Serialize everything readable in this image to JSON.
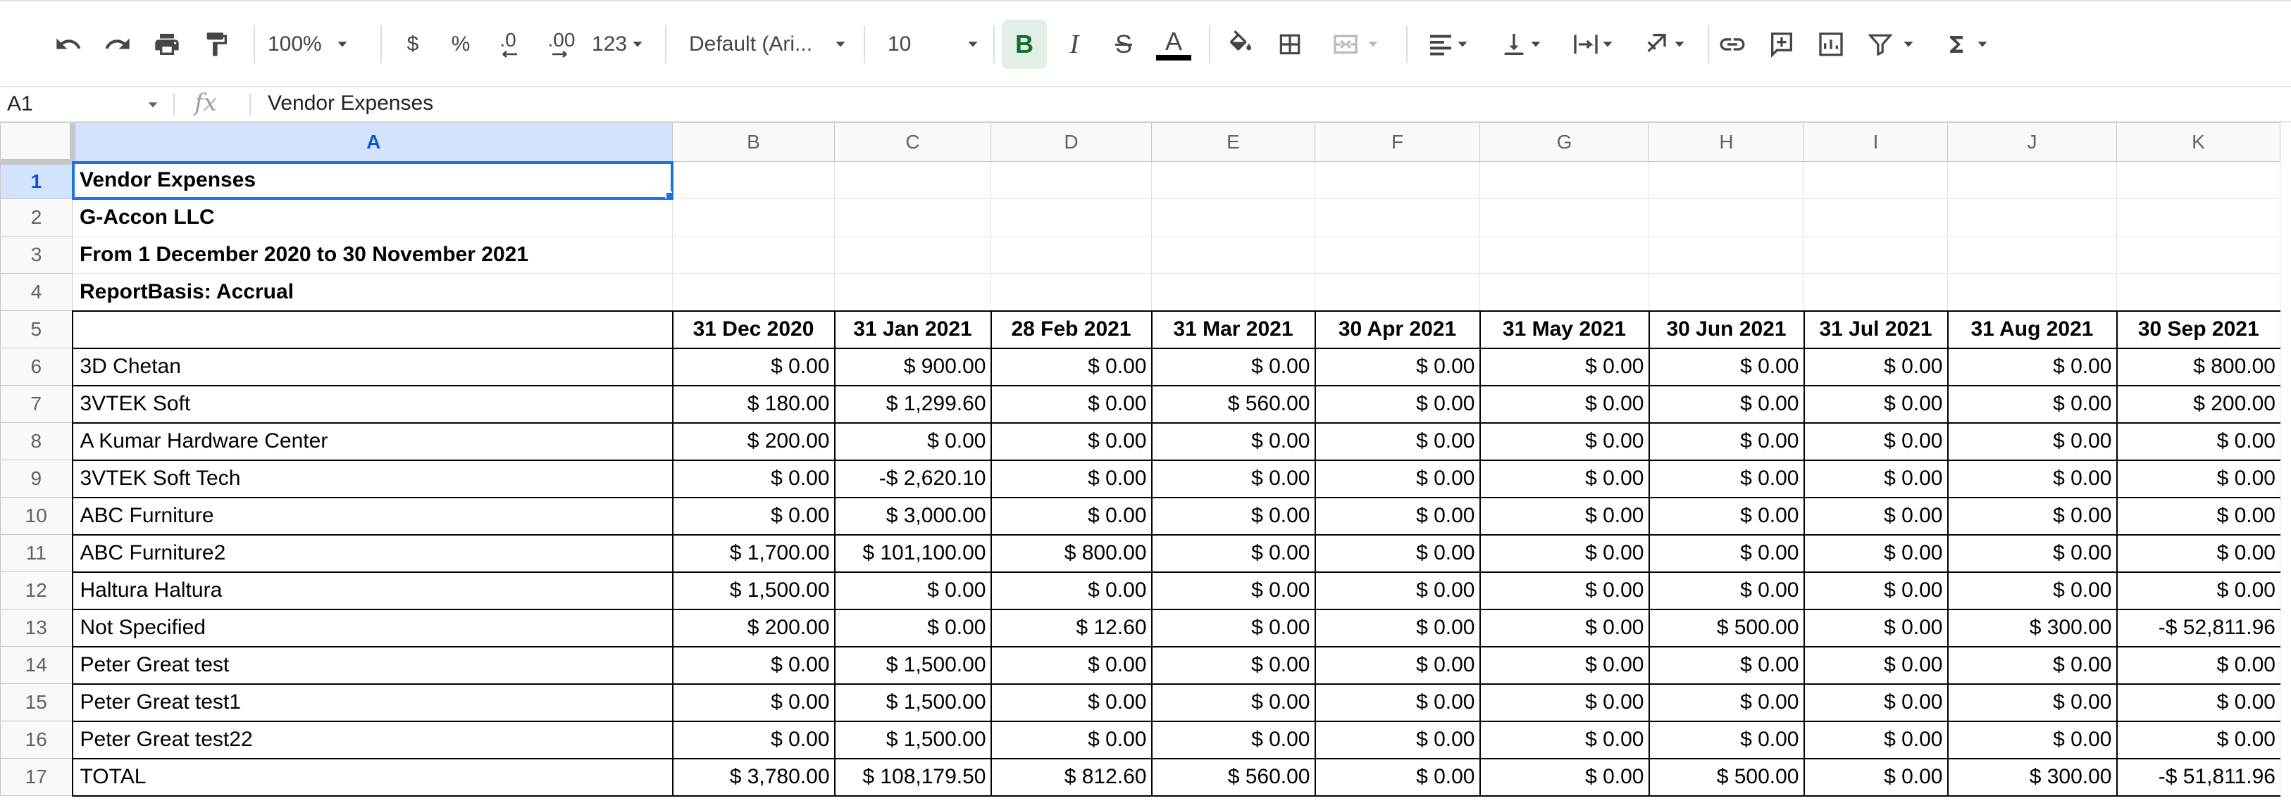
{
  "toolbar": {
    "zoom": "100%",
    "currency": "$",
    "percent": "%",
    "decrease_decimal": ".0",
    "increase_decimal": ".00",
    "more_formats": "123",
    "font_family": "Default (Ari...",
    "font_size": "10",
    "bold": "B",
    "italic": "I",
    "strikethrough": "S",
    "text_color": "A",
    "text_color_value": "#000000",
    "icons": [
      "undo-icon",
      "redo-icon",
      "print-icon",
      "paint-format-icon",
      "fill-color-icon",
      "borders-icon",
      "merge-cells-icon",
      "horizontal-align-icon",
      "vertical-align-icon",
      "text-wrapping-icon",
      "text-rotation-icon",
      "insert-link-icon",
      "insert-comment-icon",
      "insert-chart-icon",
      "filter-icon",
      "functions-icon"
    ]
  },
  "formula_bar": {
    "name_box": "A1",
    "fx": "fx",
    "content": "Vendor Expenses"
  },
  "columns": [
    "A",
    "B",
    "C",
    "D",
    "E",
    "F",
    "G",
    "H",
    "I",
    "J",
    "K"
  ],
  "rows": [
    "1",
    "2",
    "3",
    "4",
    "5",
    "6",
    "7",
    "8",
    "9",
    "10",
    "11",
    "12",
    "13",
    "14",
    "15",
    "16",
    "17"
  ],
  "report": {
    "title": "Vendor Expenses",
    "company": "G-Accon LLC",
    "period": "From 1 December 2020 to 30 November 2021",
    "basis": "ReportBasis: Accrual"
  },
  "table": {
    "headers": [
      "31 Dec 2020",
      "31 Jan 2021",
      "28 Feb 2021",
      "31 Mar 2021",
      "30 Apr 2021",
      "31 May 2021",
      "30 Jun 2021",
      "31 Jul 2021",
      "31 Aug 2021",
      "30 Sep 2021"
    ],
    "rows": [
      {
        "name": "3D Chetan",
        "values": [
          "$ 0.00",
          "$ 900.00",
          "$ 0.00",
          "$ 0.00",
          "$ 0.00",
          "$ 0.00",
          "$ 0.00",
          "$ 0.00",
          "$ 0.00",
          "$ 800.00"
        ]
      },
      {
        "name": "3VTEK Soft",
        "values": [
          "$ 180.00",
          "$ 1,299.60",
          "$ 0.00",
          "$ 560.00",
          "$ 0.00",
          "$ 0.00",
          "$ 0.00",
          "$ 0.00",
          "$ 0.00",
          "$ 200.00"
        ]
      },
      {
        "name": "A Kumar Hardware Center",
        "values": [
          "$ 200.00",
          "$ 0.00",
          "$ 0.00",
          "$ 0.00",
          "$ 0.00",
          "$ 0.00",
          "$ 0.00",
          "$ 0.00",
          "$ 0.00",
          "$ 0.00"
        ]
      },
      {
        "name": "3VTEK Soft Tech",
        "values": [
          "$ 0.00",
          "-$ 2,620.10",
          "$ 0.00",
          "$ 0.00",
          "$ 0.00",
          "$ 0.00",
          "$ 0.00",
          "$ 0.00",
          "$ 0.00",
          "$ 0.00"
        ]
      },
      {
        "name": "ABC Furniture",
        "values": [
          "$ 0.00",
          "$ 3,000.00",
          "$ 0.00",
          "$ 0.00",
          "$ 0.00",
          "$ 0.00",
          "$ 0.00",
          "$ 0.00",
          "$ 0.00",
          "$ 0.00"
        ]
      },
      {
        "name": "ABC Furniture2",
        "values": [
          "$ 1,700.00",
          "$ 101,100.00",
          "$ 800.00",
          "$ 0.00",
          "$ 0.00",
          "$ 0.00",
          "$ 0.00",
          "$ 0.00",
          "$ 0.00",
          "$ 0.00"
        ]
      },
      {
        "name": "Haltura Haltura",
        "values": [
          "$ 1,500.00",
          "$ 0.00",
          "$ 0.00",
          "$ 0.00",
          "$ 0.00",
          "$ 0.00",
          "$ 0.00",
          "$ 0.00",
          "$ 0.00",
          "$ 0.00"
        ]
      },
      {
        "name": "Not Specified",
        "values": [
          "$ 200.00",
          "$ 0.00",
          "$ 12.60",
          "$ 0.00",
          "$ 0.00",
          "$ 0.00",
          "$ 500.00",
          "$ 0.00",
          "$ 300.00",
          "-$ 52,811.96"
        ]
      },
      {
        "name": "Peter Great test",
        "values": [
          "$ 0.00",
          "$ 1,500.00",
          "$ 0.00",
          "$ 0.00",
          "$ 0.00",
          "$ 0.00",
          "$ 0.00",
          "$ 0.00",
          "$ 0.00",
          "$ 0.00"
        ]
      },
      {
        "name": "Peter Great test1",
        "values": [
          "$ 0.00",
          "$ 1,500.00",
          "$ 0.00",
          "$ 0.00",
          "$ 0.00",
          "$ 0.00",
          "$ 0.00",
          "$ 0.00",
          "$ 0.00",
          "$ 0.00"
        ]
      },
      {
        "name": "Peter Great test22",
        "values": [
          "$ 0.00",
          "$ 1,500.00",
          "$ 0.00",
          "$ 0.00",
          "$ 0.00",
          "$ 0.00",
          "$ 0.00",
          "$ 0.00",
          "$ 0.00",
          "$ 0.00"
        ]
      },
      {
        "name": "TOTAL",
        "values": [
          "$ 3,780.00",
          "$ 108,179.50",
          "$ 812.60",
          "$ 560.00",
          "$ 0.00",
          "$ 0.00",
          "$ 500.00",
          "$ 0.00",
          "$ 300.00",
          "-$ 51,811.96"
        ]
      }
    ]
  },
  "colors": {
    "selection_blue": "#1a73e8",
    "bold_active_bg": "#e3efe6",
    "header_bg": "#f8f9fa"
  }
}
